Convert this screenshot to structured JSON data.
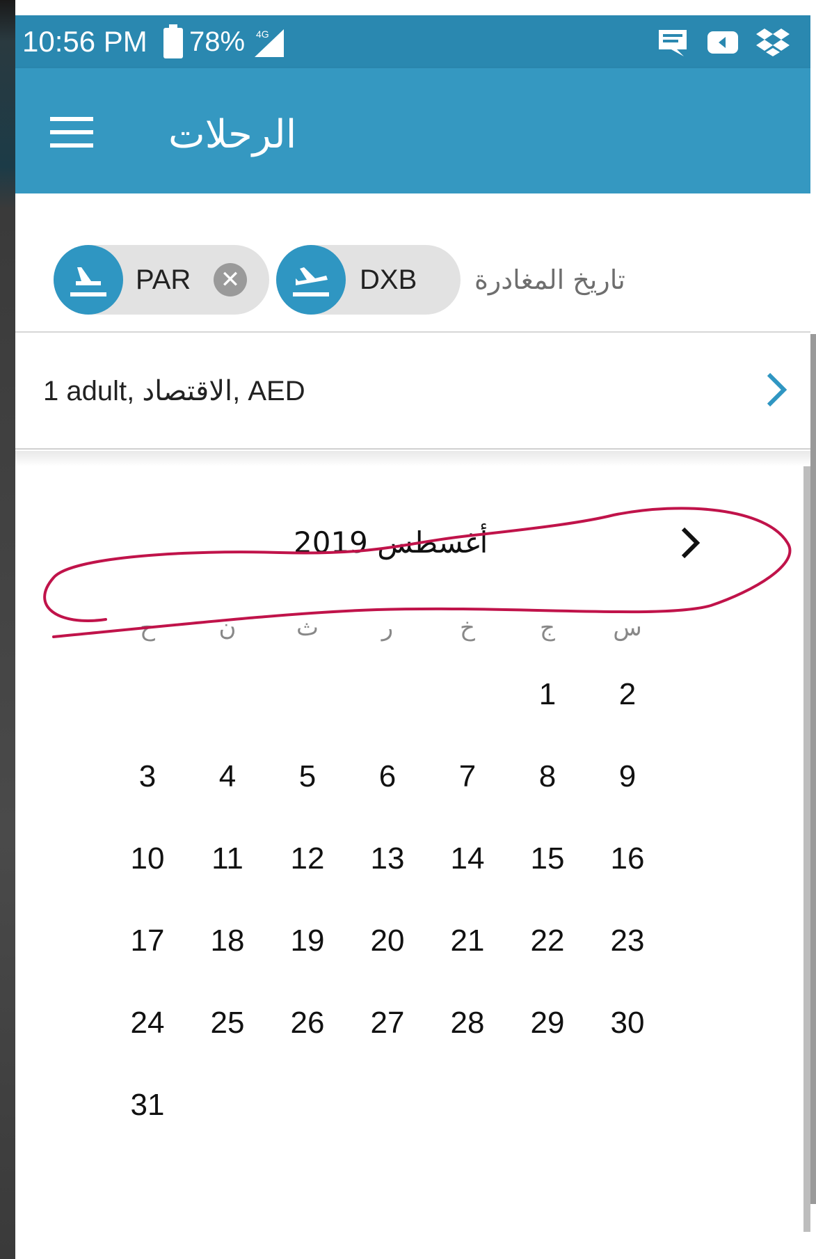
{
  "status_bar": {
    "time": "10:56 PM",
    "battery": "78%",
    "network": "4G"
  },
  "app_bar": {
    "title": "الرحلات"
  },
  "route": {
    "origin_code": "PAR",
    "destination_code": "DXB",
    "destination_label": "تاريخ المغادرة"
  },
  "passengers": {
    "summary": "1 adult, الاقتصاد, AED"
  },
  "calendar": {
    "month_title": "أغسطس 2019",
    "weekdays": [
      "ح",
      "ن",
      "ث",
      "ر",
      "خ",
      "ج",
      "س"
    ],
    "rows": [
      [
        "",
        "",
        "",
        "",
        "",
        "1",
        "2"
      ],
      [
        "3",
        "4",
        "5",
        "6",
        "7",
        "8",
        "9"
      ],
      [
        "10",
        "11",
        "12",
        "13",
        "14",
        "15",
        "16"
      ],
      [
        "17",
        "18",
        "19",
        "20",
        "21",
        "22",
        "23"
      ],
      [
        "24",
        "25",
        "26",
        "27",
        "28",
        "29",
        "30"
      ],
      [
        "31",
        "",
        "",
        "",
        "",
        "",
        ""
      ]
    ]
  },
  "colors": {
    "status_bar": "#2a88b0",
    "app_bar": "#3598c1",
    "chip": "#e2e2e2",
    "chip_avatar": "#2f96c2",
    "annotation": "#c0134a"
  },
  "icons": {
    "menu": "menu-icon",
    "takeoff": "airplane-takeoff-icon",
    "landing": "airplane-landing-icon",
    "close": "close-icon",
    "chevron": "chevron-right-icon"
  }
}
